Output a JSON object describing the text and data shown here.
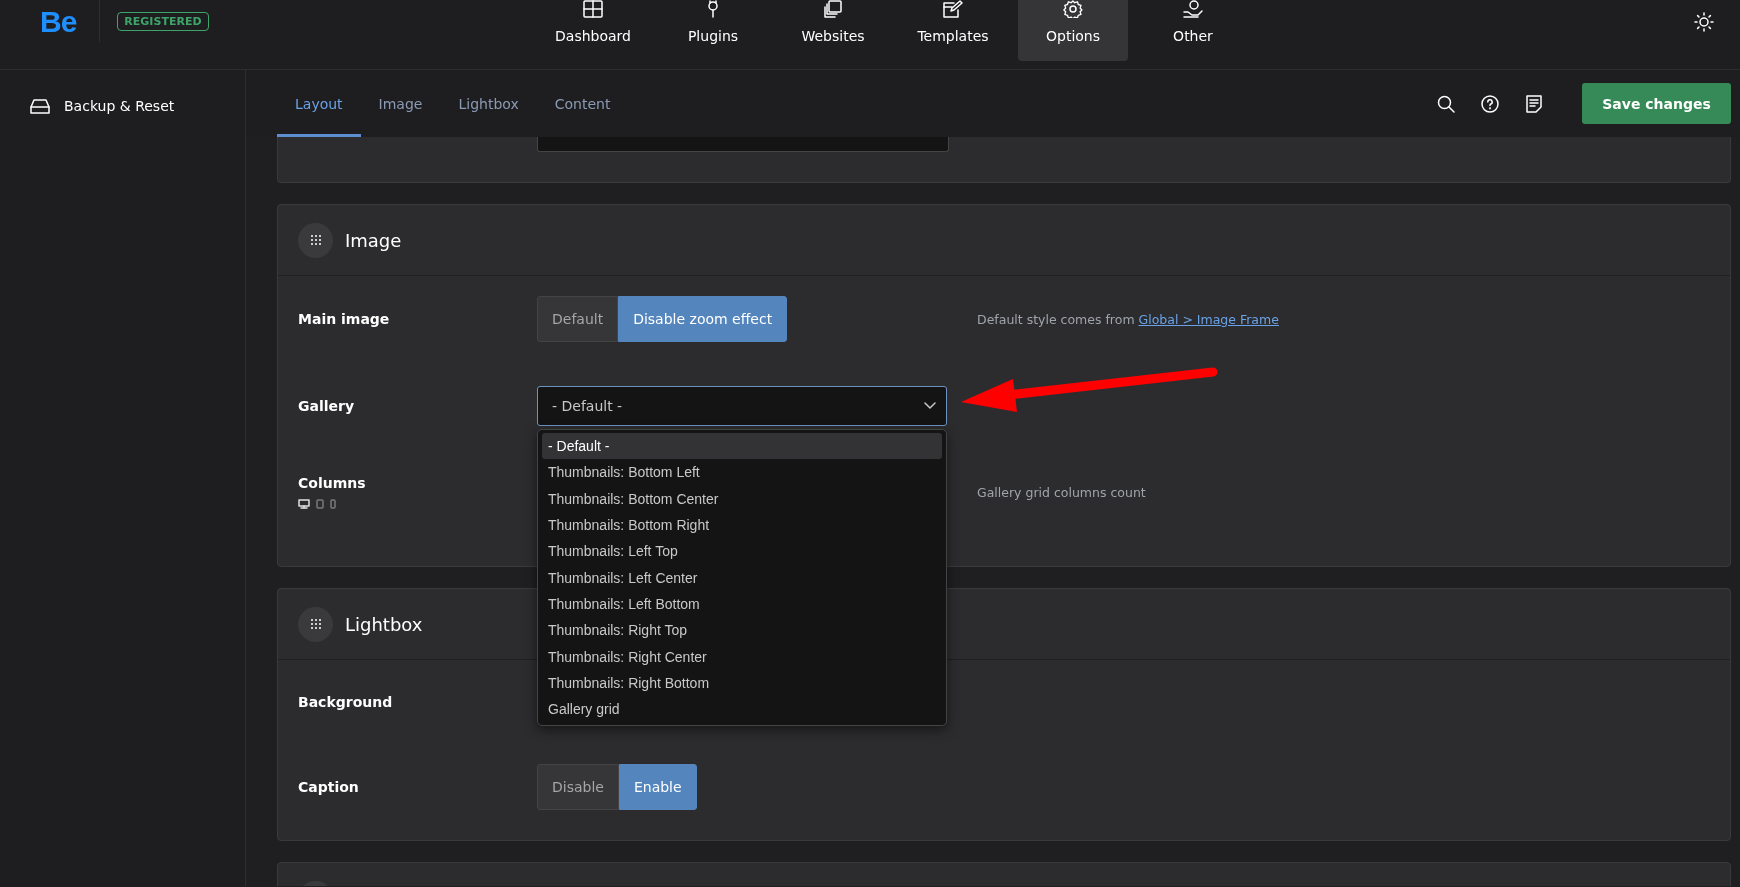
{
  "header": {
    "logo": "Be",
    "badge": "REGISTERED",
    "nav": [
      {
        "label": "Dashboard",
        "kind": "grid",
        "selected": false
      },
      {
        "label": "Plugins",
        "kind": "plug",
        "selected": false
      },
      {
        "label": "Websites",
        "kind": "copies",
        "selected": false
      },
      {
        "label": "Templates",
        "kind": "edit",
        "selected": false
      },
      {
        "label": "Options",
        "kind": "gear",
        "selected": true
      },
      {
        "label": "Other",
        "kind": "hand",
        "selected": false
      }
    ]
  },
  "sidebar": {
    "items": [
      {
        "label": "Backup & Reset",
        "kind": "drive"
      }
    ]
  },
  "tabs": [
    {
      "label": "Layout",
      "selected": true
    },
    {
      "label": "Image",
      "selected": false
    },
    {
      "label": "Lightbox",
      "selected": false
    },
    {
      "label": "Content",
      "selected": false
    }
  ],
  "toolbar": {
    "save_button": "Save changes"
  },
  "sections": [
    {
      "title": "Image",
      "rows": [
        {
          "kind": "segmented",
          "label": "Main image",
          "options": [
            {
              "label": "Default",
              "selected": false
            },
            {
              "label": "Disable zoom effect",
              "selected": true
            }
          ],
          "hint": "Default style comes from ",
          "hint_link": "Global > Image Frame"
        },
        {
          "kind": "select",
          "label": "Gallery",
          "value": "- Default -",
          "expanded": true,
          "options": [
            {
              "label": "- Default -",
              "selected": true
            },
            {
              "label": "Thumbnails: Bottom Left",
              "selected": false
            },
            {
              "label": "Thumbnails: Bottom Center",
              "selected": false
            },
            {
              "label": "Thumbnails: Bottom Right",
              "selected": false
            },
            {
              "label": "Thumbnails: Left Top",
              "selected": false
            },
            {
              "label": "Thumbnails: Left Center",
              "selected": false
            },
            {
              "label": "Thumbnails: Left Bottom",
              "selected": false
            },
            {
              "label": "Thumbnails: Right Top",
              "selected": false
            },
            {
              "label": "Thumbnails: Right Center",
              "selected": false
            },
            {
              "label": "Thumbnails: Right Bottom",
              "selected": false
            },
            {
              "label": "Gallery grid",
              "selected": false
            }
          ]
        },
        {
          "kind": "responsive",
          "label": "Columns",
          "devices": [
            {
              "kind": "desktop",
              "selected": true
            },
            {
              "kind": "tablet",
              "selected": false
            },
            {
              "kind": "mobile",
              "selected": false
            }
          ],
          "hint": "Gallery grid columns count"
        }
      ]
    },
    {
      "title": "Lightbox",
      "rows": [
        {
          "kind": "blank",
          "label": "Background"
        },
        {
          "kind": "segmented",
          "label": "Caption",
          "options": [
            {
              "label": "Disable",
              "selected": false
            },
            {
              "label": "Enable",
              "selected": true
            }
          ]
        }
      ]
    }
  ]
}
